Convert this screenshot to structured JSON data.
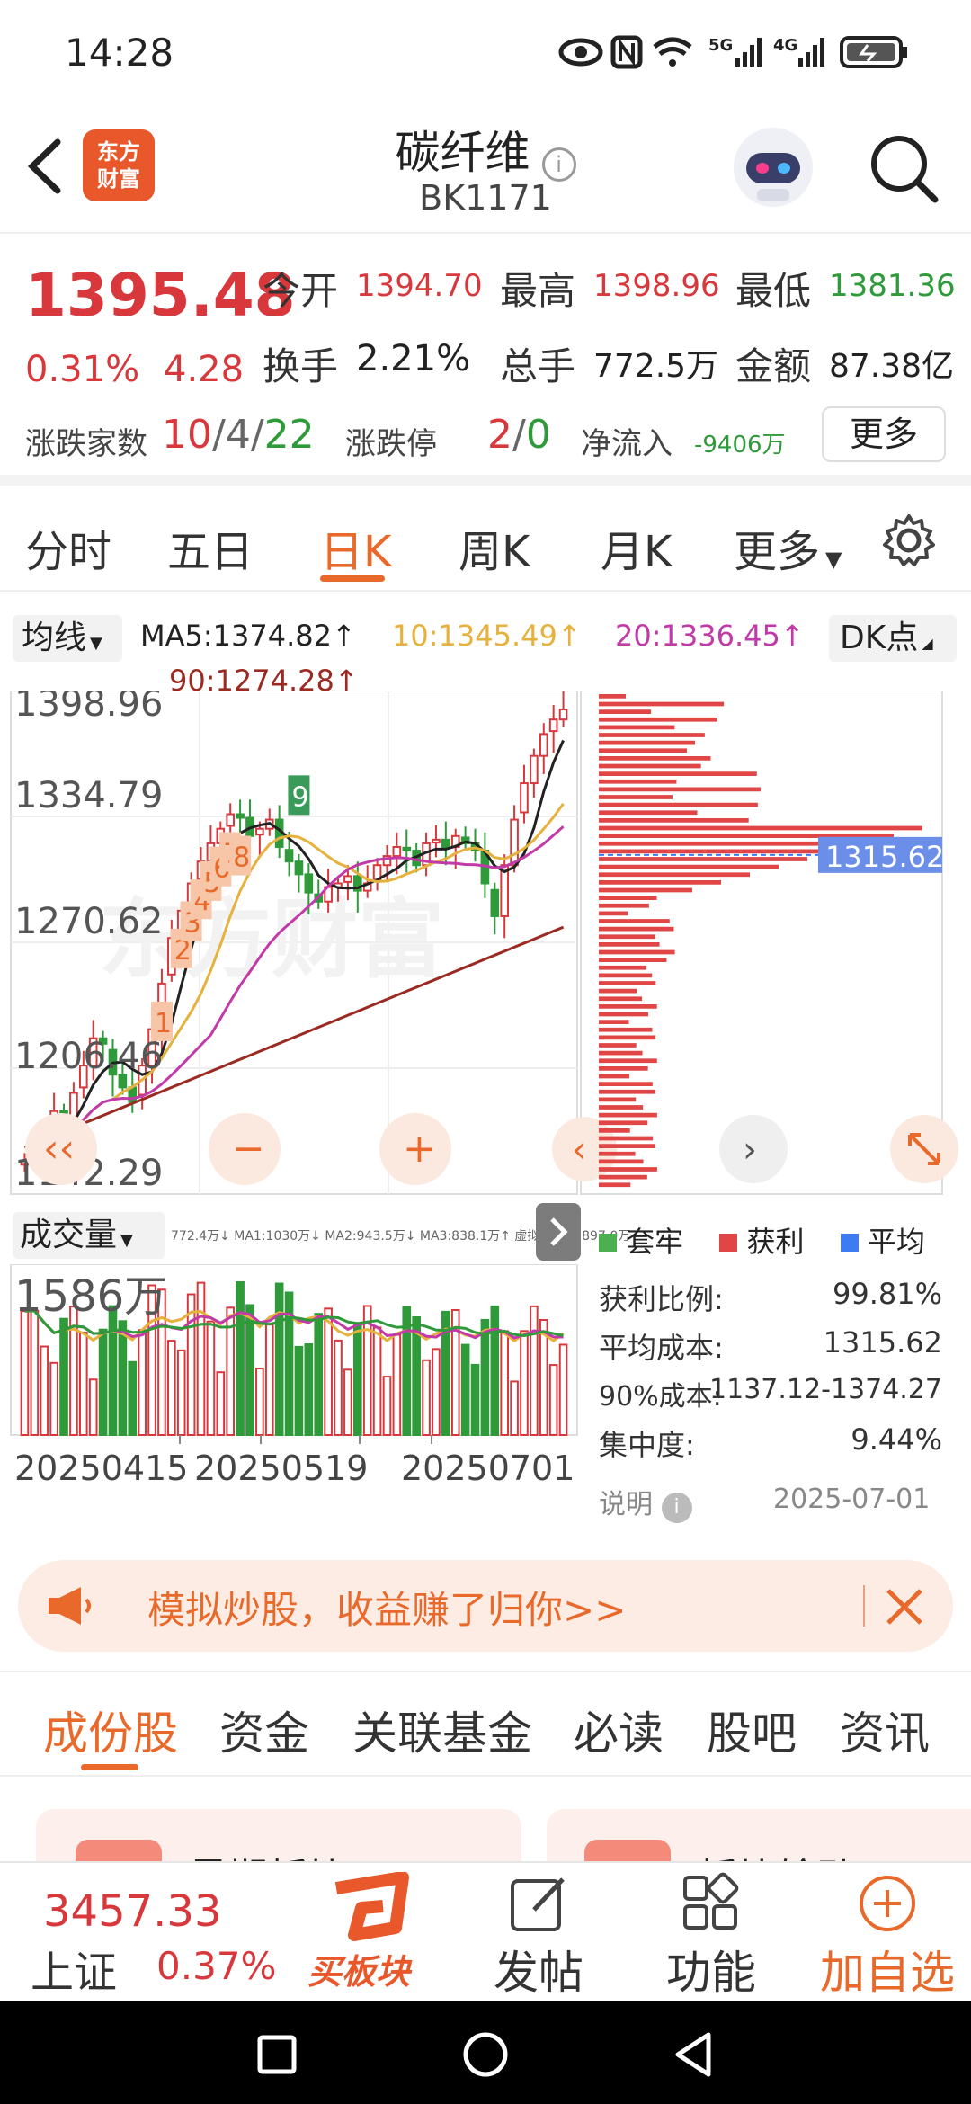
{
  "status": {
    "time": "14:28",
    "network1": "5G",
    "network2": "4G"
  },
  "header": {
    "app_logo": "东方\n财富",
    "title": "碳纤维",
    "code": "BK1171"
  },
  "quote": {
    "price": "1395.48",
    "change_pct": "0.31%",
    "change": "4.28",
    "fields": [
      {
        "label": "今开",
        "value": "1394.70"
      },
      {
        "label": "最高",
        "value": "1398.96"
      },
      {
        "label": "最低",
        "value": "1381.36"
      },
      {
        "label": "换手",
        "value": "2.21%"
      },
      {
        "label": "总手",
        "value": "772.5万"
      },
      {
        "label": "金额",
        "value": "87.38亿"
      }
    ],
    "updown_label": "涨跌家数",
    "up": "10",
    "flat": "4",
    "down": "22",
    "sep": "/",
    "limit_label": "涨跌停",
    "limit_up": "2",
    "limit_down": "0",
    "netflow_label": "净流入",
    "netflow": "-9406万",
    "more": "更多"
  },
  "tabs": [
    "分时",
    "五日",
    "日K",
    "周K",
    "月K",
    "更多"
  ],
  "active_tab": "日K",
  "chart": {
    "ma_selector": "均线",
    "ma5": "MA5:1374.82↑",
    "ma10": "10:1345.49↑",
    "ma20": "20:1336.45↑",
    "ma90": "90:1274.28↑",
    "dk_button": "DK点",
    "y_labels": [
      "1398.96",
      "1334.79",
      "1270.62",
      "1206.46",
      "1142.29"
    ],
    "watermark": "东方财富",
    "vol_selector": "成交量",
    "vol_ma_text": "772.4万↓ MA1:1030万↓ MA2:943.5万↓ MA3:838.1万↑ 虚拟成交量:897.0万",
    "vol_max_label": "1586万",
    "date_labels": [
      "20250415",
      "20250519",
      "20250701"
    ],
    "cost_marker": "1315.62",
    "signals": [
      "1",
      "2",
      "3",
      "4",
      "5",
      "6",
      "7",
      "8",
      "9"
    ]
  },
  "chart_data": {
    "type": "candlestick",
    "close_series_approx": [
      1148,
      1152,
      1160,
      1175,
      1172,
      1185,
      1200,
      1215,
      1212,
      1195,
      1188,
      1180,
      1200,
      1220,
      1245,
      1270,
      1285,
      1300,
      1312,
      1322,
      1330,
      1338,
      1336,
      1326,
      1330,
      1335,
      1320,
      1312,
      1305,
      1295,
      1290,
      1298,
      1300,
      1304,
      1296,
      1300,
      1310,
      1315,
      1320,
      1318,
      1310,
      1322,
      1324,
      1320,
      1326,
      1322,
      1318,
      1300,
      1282,
      1310,
      1335,
      1355,
      1370,
      1382,
      1390,
      1395.48
    ],
    "ylim": [
      1142.29,
      1398.96
    ]
  },
  "chips": {
    "legend": [
      {
        "label": "套牢",
        "color": "#4caf50"
      },
      {
        "label": "获利",
        "color": "#e04646"
      },
      {
        "label": "平均",
        "color": "#3d7bf0"
      }
    ],
    "stats": [
      {
        "label": "获利比例:",
        "value": "99.81%"
      },
      {
        "label": "平均成本:",
        "value": "1315.62"
      },
      {
        "label": "90%成本:",
        "value": "1137.12-1374.27"
      },
      {
        "label": "集中度:",
        "value": "9.44%"
      }
    ],
    "note": "说明",
    "date": "2025-07-01"
  },
  "promo": {
    "text": "模拟炒股，收益赚了归你>>"
  },
  "content_tabs": [
    "成份股",
    "资金",
    "关联基金",
    "必读",
    "股吧",
    "资讯"
  ],
  "content_cards": [
    "暑期板块",
    "板块轮动"
  ],
  "bottom": {
    "index_value": "3457.33",
    "index_name": "上证",
    "index_change": "0.37%",
    "buy_label": "买板块",
    "post_label": "发帖",
    "func_label": "功能",
    "add_label": "加自选"
  },
  "colors": {
    "up": "#d8383c",
    "down": "#2e9a3a",
    "accent": "#e8692a"
  }
}
